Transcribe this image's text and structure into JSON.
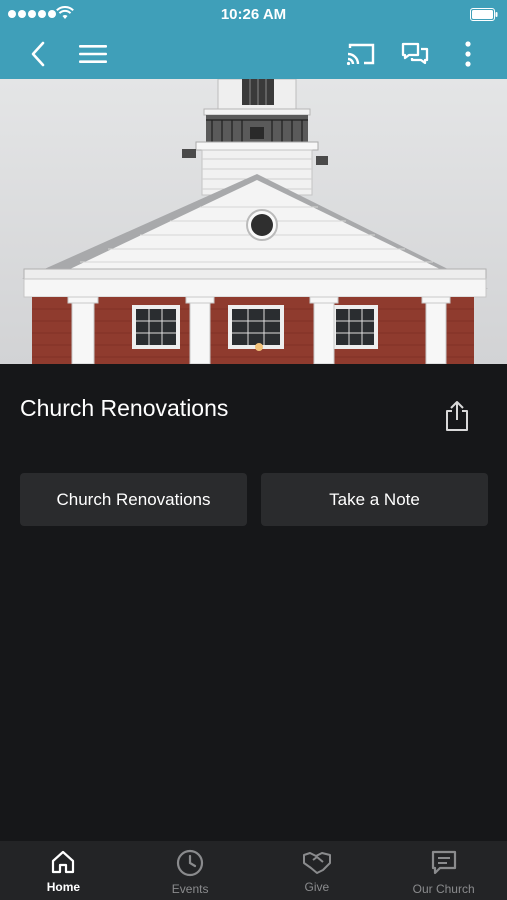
{
  "status_bar": {
    "time": "10:26 AM"
  },
  "nav": {
    "back_icon": "chevron-left-icon",
    "menu_icon": "hamburger-menu-icon",
    "cast_icon": "cast-icon",
    "chat_icon": "chat-bubbles-icon",
    "more_icon": "more-vertical-icon",
    "bar_color": "#3f9fb9"
  },
  "hero": {
    "subject": "church-steeple-photo"
  },
  "content": {
    "title": "Church Renovations",
    "share_icon": "share-icon",
    "buttons": [
      {
        "label": "Church Renovations"
      },
      {
        "label": "Take a Note"
      }
    ]
  },
  "tabs": [
    {
      "label": "Home",
      "icon": "home-icon",
      "active": true
    },
    {
      "label": "Events",
      "icon": "clock-icon",
      "active": false
    },
    {
      "label": "Give",
      "icon": "handshake-icon",
      "active": false
    },
    {
      "label": "Our Church",
      "icon": "message-icon",
      "active": false
    }
  ]
}
